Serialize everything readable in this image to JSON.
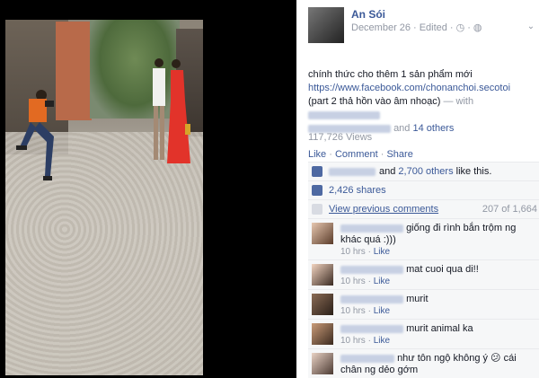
{
  "post": {
    "author": "An Sói",
    "date": "December 26",
    "edited": "Edited",
    "text_line1": "chính thức cho thêm 1 sản phẩm mới",
    "link": "https://www.facebook.com/chonanchoi.secotoi",
    "text_line2": "(part 2 thả hồn vào âm nhoạc)",
    "with_label": "— with",
    "and_label": "and",
    "others_link": "14 others",
    "views": "117,726 Views",
    "actions": {
      "like": "Like",
      "comment": "Comment",
      "share": "Share",
      "sep": "·"
    }
  },
  "ufi": {
    "likes_text": "and",
    "likes_others": "2,700 others",
    "likes_suffix": "like this.",
    "shares": "2,426 shares",
    "view_previous": "View previous comments",
    "count": "207 of 1,664"
  },
  "comments": [
    {
      "text": "giống đi rình bắn trộm ng khác quá :)))",
      "time": "10 hrs",
      "like": "Like"
    },
    {
      "text": "mat cuoi qua di!!",
      "time": "10 hrs",
      "like": "Like"
    },
    {
      "text": "murit",
      "time": "10 hrs",
      "like": "Like"
    },
    {
      "text": "murit animal ka",
      "time": "10 hrs",
      "like": "Like"
    },
    {
      "text": "như tôn ngộ không ý 😕 cái chân ng dẻo gớm",
      "time": "",
      "like": ""
    }
  ],
  "colors": {
    "link": "#3b5998",
    "muted": "#9197a3",
    "ufi_bg": "#f6f7f8"
  }
}
